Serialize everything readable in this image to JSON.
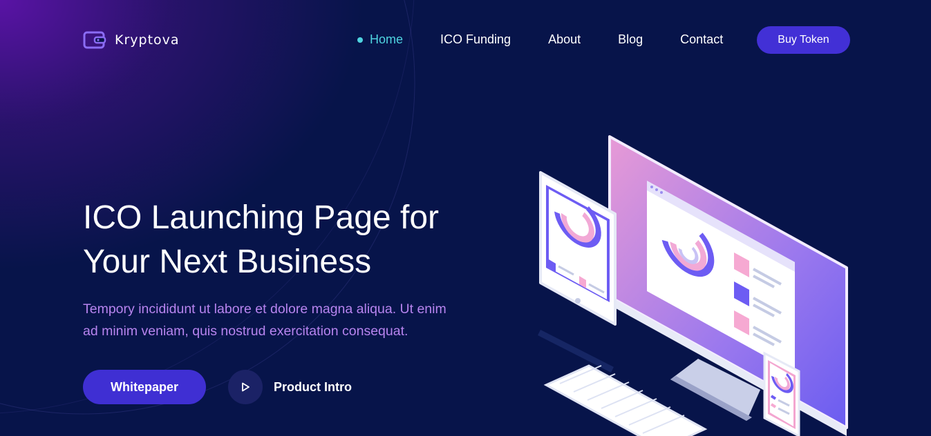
{
  "brand": {
    "name": "Kryptova",
    "logo_icon": "wallet-icon"
  },
  "nav": {
    "items": [
      {
        "label": "Home",
        "active": true
      },
      {
        "label": "ICO Funding",
        "active": false
      },
      {
        "label": "About",
        "active": false
      },
      {
        "label": "Blog",
        "active": false
      },
      {
        "label": "Contact",
        "active": false
      }
    ],
    "cta_label": "Buy Token"
  },
  "hero": {
    "title_line1": "ICO Launching Page for",
    "title_line2": "Your Next Business",
    "text_line1": "Tempory incididunt ut labore et dolore magna aliqua. Ut enim",
    "text_line2": "ad minim veniam, quis nostrud exercitation consequat.",
    "primary_button": "Whitepaper",
    "secondary_button": "Product Intro",
    "secondary_icon": "play-icon"
  },
  "colors": {
    "background": "#07144a",
    "accent": "#4230d6",
    "active_link": "#4fd3e0",
    "subtitle": "#b784ef"
  }
}
